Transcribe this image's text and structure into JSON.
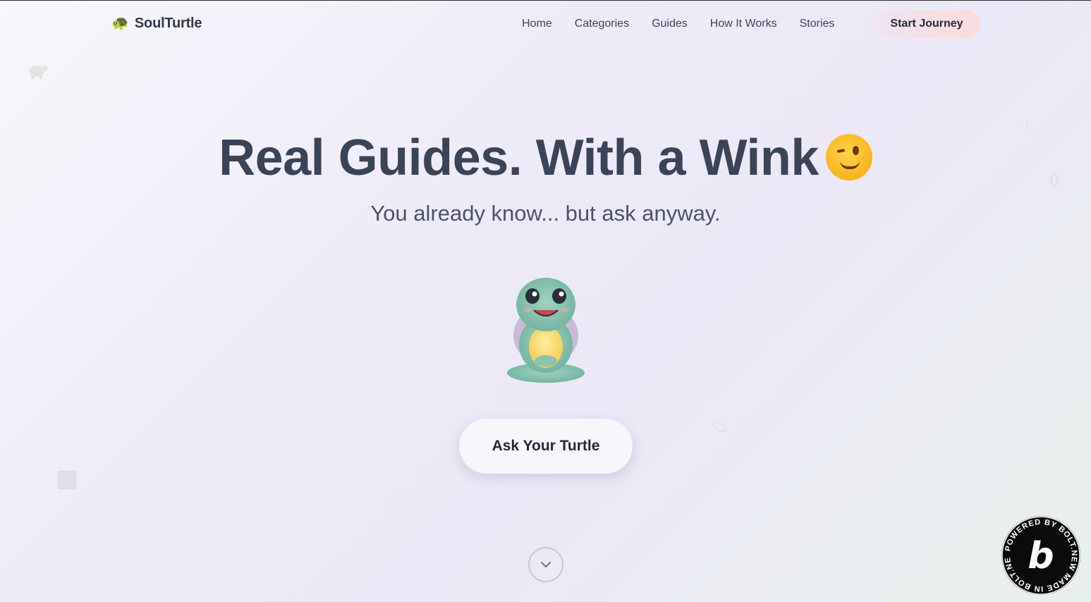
{
  "brand": {
    "icon": "🐢",
    "name": "SoulTurtle"
  },
  "nav": {
    "links": [
      "Home",
      "Categories",
      "Guides",
      "How It Works",
      "Stories"
    ],
    "cta": "Start Journey"
  },
  "hero": {
    "headline": "Real Guides. With a Wink",
    "headline_emoji": "wink-emoji-icon",
    "subtitle": "You already know... but ask anyway.",
    "illustration": "meditating-turtle-icon",
    "button": "Ask Your Turtle"
  },
  "scroll_icon": "chevron-down-icon",
  "badge": {
    "text": "POWERED BY BOLT.NEW MADE IN BOLT.NEW",
    "letter": "b"
  }
}
